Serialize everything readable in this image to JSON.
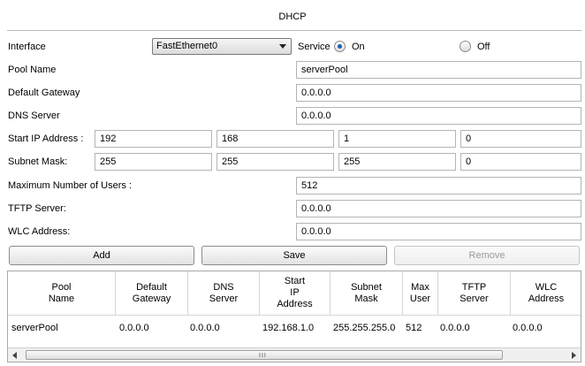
{
  "title": "DHCP",
  "interface": {
    "label": "Interface",
    "selected": "FastEthernet0"
  },
  "service": {
    "label": "Service",
    "on_label": "On",
    "off_label": "Off",
    "on_selected": true
  },
  "pool_name": {
    "label": "Pool Name",
    "value": "serverPool"
  },
  "default_gateway": {
    "label": "Default Gateway",
    "value": "0.0.0.0"
  },
  "dns_server": {
    "label": "DNS Server",
    "value": "0.0.0.0"
  },
  "start_ip": {
    "label": "Start IP Address :",
    "octets": [
      "192",
      "168",
      "1",
      "0"
    ]
  },
  "subnet_mask": {
    "label": "Subnet Mask:",
    "octets": [
      "255",
      "255",
      "255",
      "0"
    ]
  },
  "max_users": {
    "label": "Maximum Number of Users :",
    "value": "512"
  },
  "tftp_server": {
    "label": "TFTP Server:",
    "value": "0.0.0.0"
  },
  "wlc_address": {
    "label": "WLC Address:",
    "value": "0.0.0.0"
  },
  "buttons": {
    "add": "Add",
    "save": "Save",
    "remove": "Remove"
  },
  "table": {
    "headers": [
      [
        "Pool",
        "Name"
      ],
      [
        "Default",
        "Gateway"
      ],
      [
        "DNS",
        "Server"
      ],
      [
        "Start",
        "IP",
        "Address"
      ],
      [
        "Subnet",
        "Mask"
      ],
      [
        "Max",
        "User"
      ],
      [
        "TFTP",
        "Server"
      ],
      [
        "WLC",
        "Address"
      ]
    ],
    "rows": [
      [
        "serverPool",
        "0.0.0.0",
        "0.0.0.0",
        "192.168.1.0",
        "255.255.255.0",
        "512",
        "0.0.0.0",
        "0.0.0.0"
      ]
    ]
  },
  "scrollbar": {
    "grip": "III"
  }
}
